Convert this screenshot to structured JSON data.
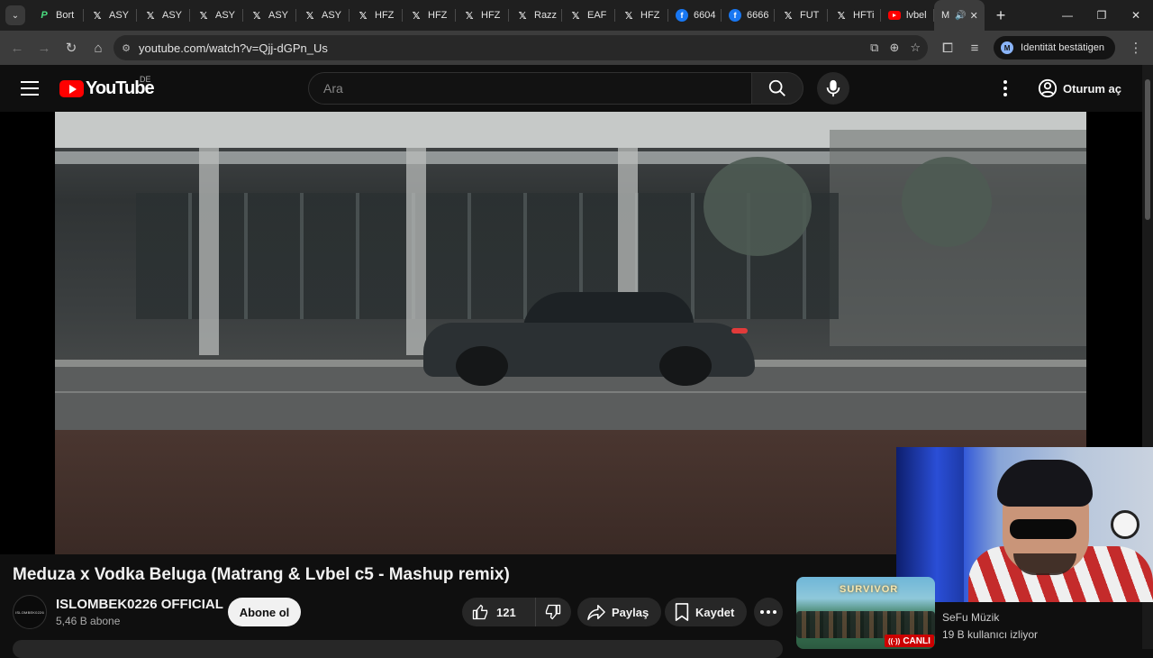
{
  "browser": {
    "tabs": [
      {
        "icon": "p-icon",
        "label": "Bort"
      },
      {
        "icon": "x-icon",
        "label": "ASY"
      },
      {
        "icon": "x-icon",
        "label": "ASY"
      },
      {
        "icon": "x-icon",
        "label": "ASY"
      },
      {
        "icon": "x-icon",
        "label": "ASY"
      },
      {
        "icon": "x-icon",
        "label": "ASY"
      },
      {
        "icon": "x-icon",
        "label": "HFZ"
      },
      {
        "icon": "x-icon",
        "label": "HFZ"
      },
      {
        "icon": "x-icon",
        "label": "HFZ"
      },
      {
        "icon": "x-icon",
        "label": "Razz"
      },
      {
        "icon": "x-icon",
        "label": "EAF"
      },
      {
        "icon": "x-icon",
        "label": "HFZ"
      },
      {
        "icon": "facebook-icon",
        "label": "6604"
      },
      {
        "icon": "facebook-icon",
        "label": "6666"
      },
      {
        "icon": "x-icon",
        "label": "FUT"
      },
      {
        "icon": "x-icon",
        "label": "HFTi"
      },
      {
        "icon": "youtube-icon",
        "label": "lvbel"
      }
    ],
    "active_tab_label": "M",
    "url": "youtube.com/watch?v=Qjj-dGPn_Us",
    "identity_label": "Identität bestätigen"
  },
  "youtube": {
    "logo_text": "YouTube",
    "country_code": "DE",
    "search_placeholder": "Ara",
    "signin_label": "Oturum aç"
  },
  "video": {
    "title": "Meduza x Vodka Beluga (Matrang & Lvbel c5 - Mashup remix)",
    "channel_name": "ISLOMBEK0226 OFFICIAL",
    "avatar_text": "ISLOMBEK0226",
    "subscribers": "5,46 B abone",
    "subscribe_label": "Abone ol",
    "like_count": "121",
    "share_label": "Paylaş",
    "save_label": "Kaydet"
  },
  "recommendation": {
    "thumbnail_brand": "SURVIVOR",
    "live_label": "CANLI",
    "channel": "SeFu Müzik",
    "viewers": "19 B kullanıcı izliyor"
  },
  "colors": {
    "youtube_red": "#ff0000",
    "background": "#0f0f0f",
    "chip": "#272727"
  }
}
